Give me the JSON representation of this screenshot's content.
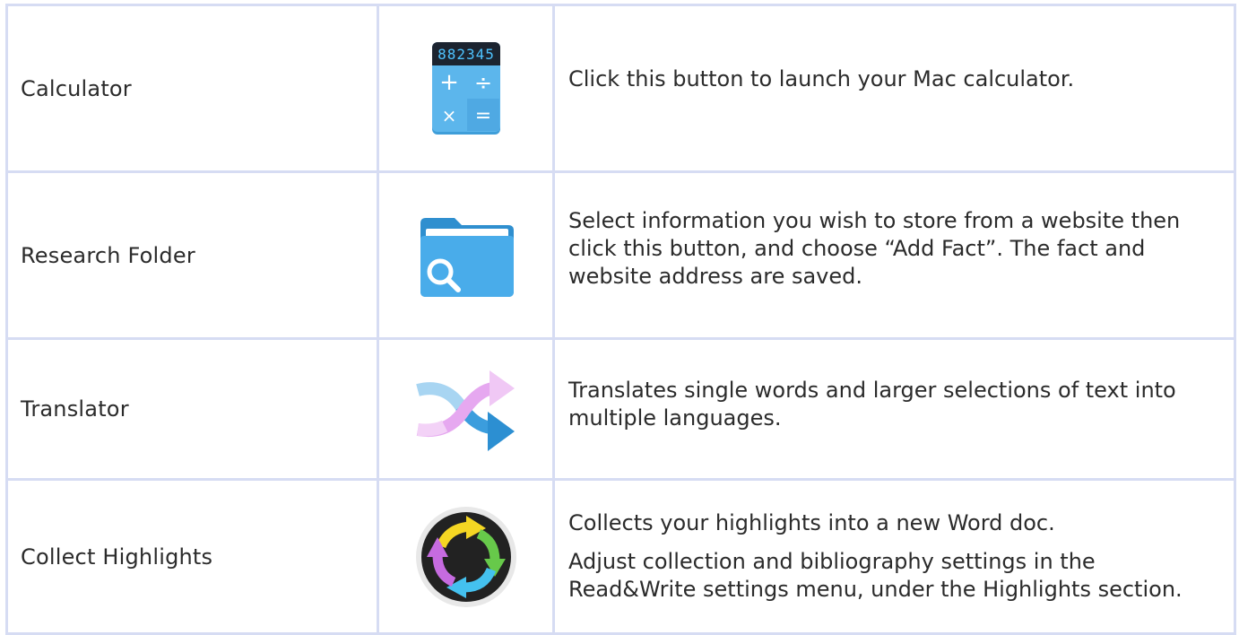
{
  "rows": [
    {
      "name": "Calculator",
      "icon": "calculator-icon",
      "display": "882345",
      "description": [
        "Click this button to launch your Mac calculator."
      ]
    },
    {
      "name": "Research Folder",
      "icon": "research-folder-icon",
      "description": [
        "Select information you wish to store from a website then click this button, and choose “Add Fact”. The fact and website address are saved."
      ]
    },
    {
      "name": "Translator",
      "icon": "translator-icon",
      "description": [
        "Translates single words and larger selections of text into multiple languages."
      ]
    },
    {
      "name": "Collect Highlights",
      "icon": "collect-highlights-icon",
      "description": [
        "Collects your highlights into a new Word doc.",
        "Adjust collection and bibliography settings in the Read&Write settings menu, under the Highlights section."
      ]
    }
  ],
  "colors": {
    "border": "#d6dcf3",
    "text": "#2b2b2b",
    "calc_blue": "#4aa9e4",
    "folder_blue": "#3fa4e0"
  }
}
